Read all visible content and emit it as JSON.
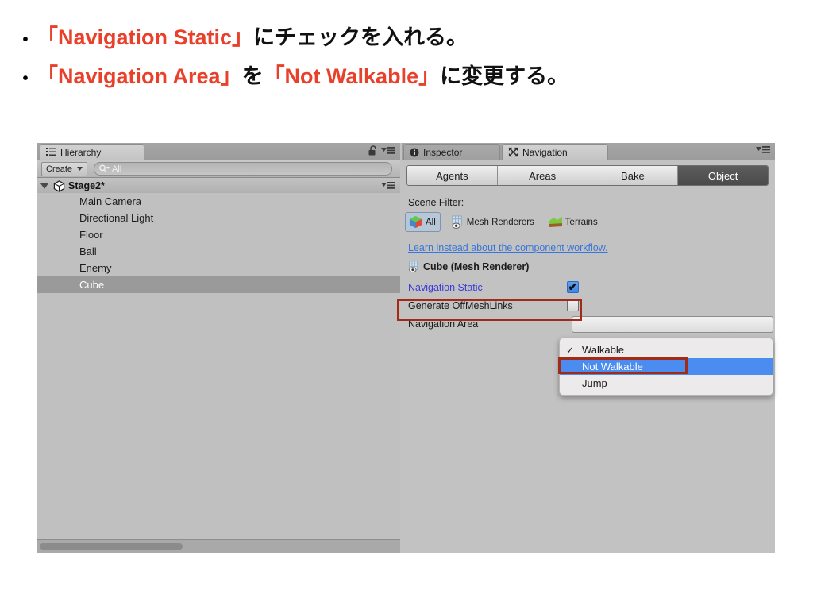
{
  "slide": {
    "bullets": [
      {
        "marker": "•",
        "parts": [
          {
            "text": "「Navigation Static」",
            "color": "red"
          },
          {
            "text": "にチェックを入れる。",
            "color": "black"
          }
        ]
      },
      {
        "marker": "•",
        "parts": [
          {
            "text": "「Navigation Area」",
            "color": "red"
          },
          {
            "text": " を ",
            "color": "black"
          },
          {
            "text": "「Not Walkable」",
            "color": "red"
          },
          {
            "text": " に変更する。",
            "color": "black"
          }
        ]
      }
    ],
    "accent_color": "#e8402a",
    "text_color": "#111111"
  },
  "hierarchy": {
    "tab_label": "Hierarchy",
    "tab_icon": "list-icon",
    "lock_icon": "lock-open-icon",
    "menu_icon": "panel-menu-icon",
    "create_button": "Create",
    "search_placeholder": "All",
    "search_value": "",
    "search_icon": "search-icon",
    "scene_name": "Stage2*",
    "scene_icon": "unity-scene-icon",
    "items": [
      {
        "label": "Main Camera",
        "selected": false
      },
      {
        "label": "Directional Light",
        "selected": false
      },
      {
        "label": "Floor",
        "selected": false
      },
      {
        "label": "Ball",
        "selected": false
      },
      {
        "label": "Enemy",
        "selected": false
      },
      {
        "label": "Cube",
        "selected": true
      }
    ]
  },
  "inspector": {
    "tabs": [
      {
        "label": "Inspector",
        "icon": "info-icon",
        "active": false
      },
      {
        "label": "Navigation",
        "icon": "navigation-icon",
        "active": true
      }
    ],
    "menu_icon": "panel-menu-icon",
    "nav_tabs": [
      {
        "label": "Agents",
        "active": false
      },
      {
        "label": "Areas",
        "active": false
      },
      {
        "label": "Bake",
        "active": false
      },
      {
        "label": "Object",
        "active": true
      }
    ],
    "scene_filter_label": "Scene Filter:",
    "filters": [
      {
        "label": "All",
        "icon": "cube-icon",
        "active": true
      },
      {
        "label": "Mesh Renderers",
        "icon": "mesh-renderer-icon",
        "active": false
      },
      {
        "label": "Terrains",
        "icon": "terrain-icon",
        "active": false
      }
    ],
    "learn_link": "Learn instead about the component workflow.",
    "object_header": "Cube (Mesh Renderer)",
    "object_header_icon": "mesh-renderer-icon",
    "properties": [
      {
        "label": "Navigation Static",
        "type": "checkbox",
        "checked": true,
        "accent": true
      },
      {
        "label": "Generate OffMeshLinks",
        "type": "checkbox",
        "checked": false,
        "accent": false
      },
      {
        "label": "Navigation Area",
        "type": "popup",
        "value": "Walkable",
        "accent": false
      }
    ]
  },
  "dropdown": {
    "items": [
      {
        "label": "Walkable",
        "checked": true,
        "highlighted": false
      },
      {
        "label": "Not Walkable",
        "checked": false,
        "highlighted": true
      },
      {
        "label": "Jump",
        "checked": false,
        "highlighted": false
      }
    ],
    "check_glyph": "✓",
    "highlight_color": "#4a8cf0"
  },
  "annotations": {
    "box_color": "#a32a16",
    "boxes": [
      {
        "target": "Navigation Static"
      },
      {
        "target": "Not Walkable"
      }
    ]
  }
}
